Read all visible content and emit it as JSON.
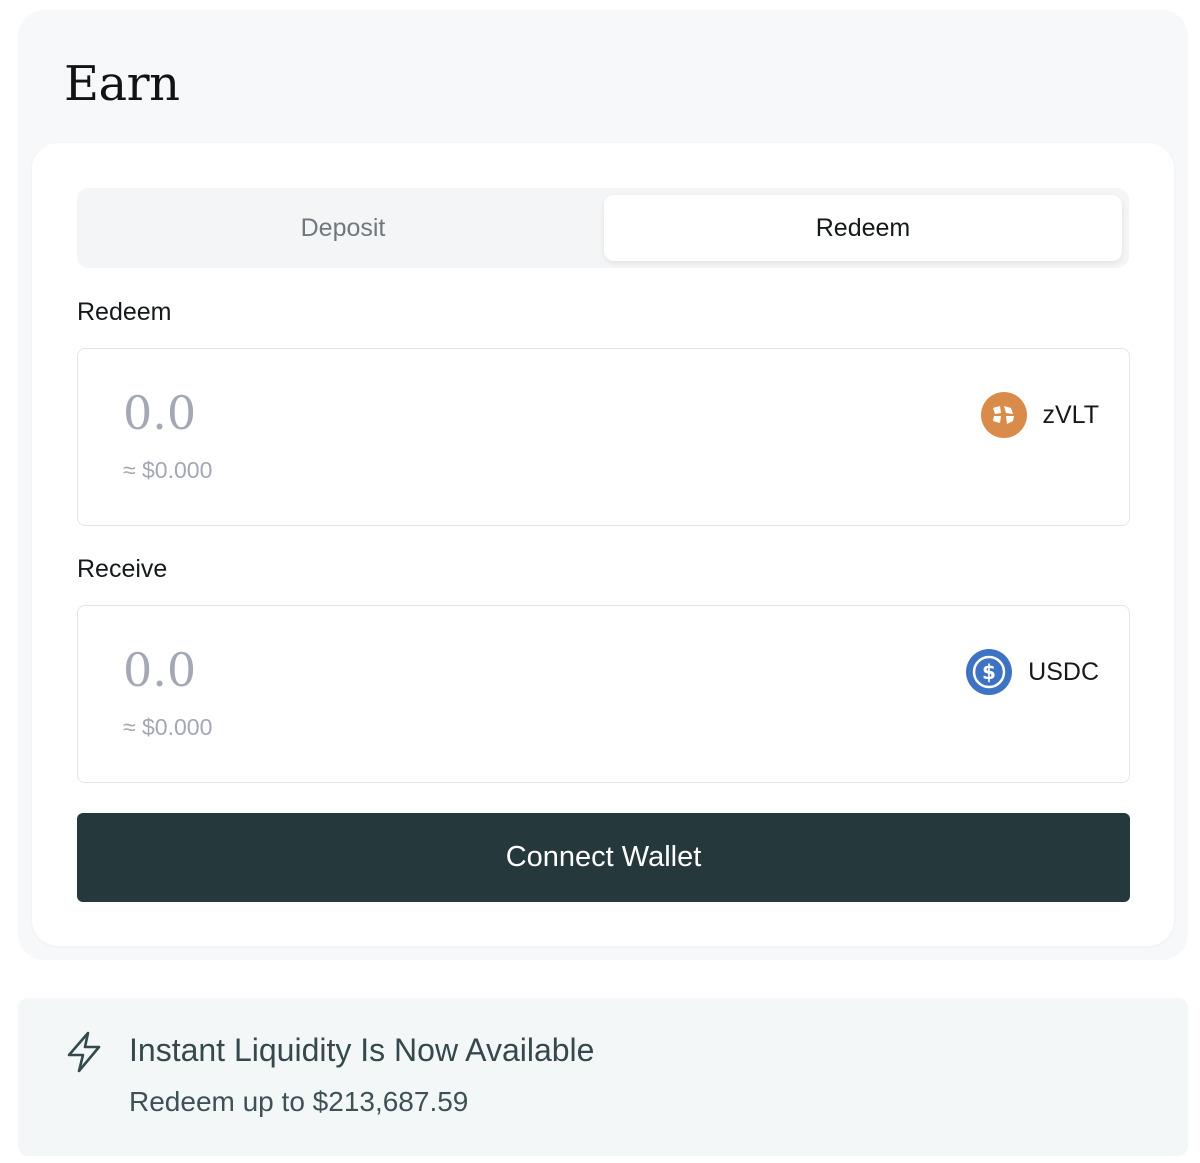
{
  "title": "Earn",
  "tabs": [
    {
      "label": "Deposit",
      "active": false
    },
    {
      "label": "Redeem",
      "active": true
    }
  ],
  "redeem_field": {
    "label": "Redeem",
    "amount_placeholder": "0.0",
    "usd_value": "≈ $0.000",
    "token": {
      "name": "zVLT",
      "icon": "zvlt-icon",
      "color": "#d98c4a"
    }
  },
  "receive_field": {
    "label": "Receive",
    "amount_placeholder": "0.0",
    "usd_value": "≈ $0.000",
    "token": {
      "name": "USDC",
      "icon": "usdc-icon",
      "color": "#3e73c4"
    }
  },
  "connect_button": {
    "label": "Connect Wallet",
    "color": "#25393d"
  },
  "banner": {
    "icon": "lightning-bolt-icon",
    "title": "Instant Liquidity Is Now Available",
    "subtitle": "Redeem up to $213,687.59"
  }
}
